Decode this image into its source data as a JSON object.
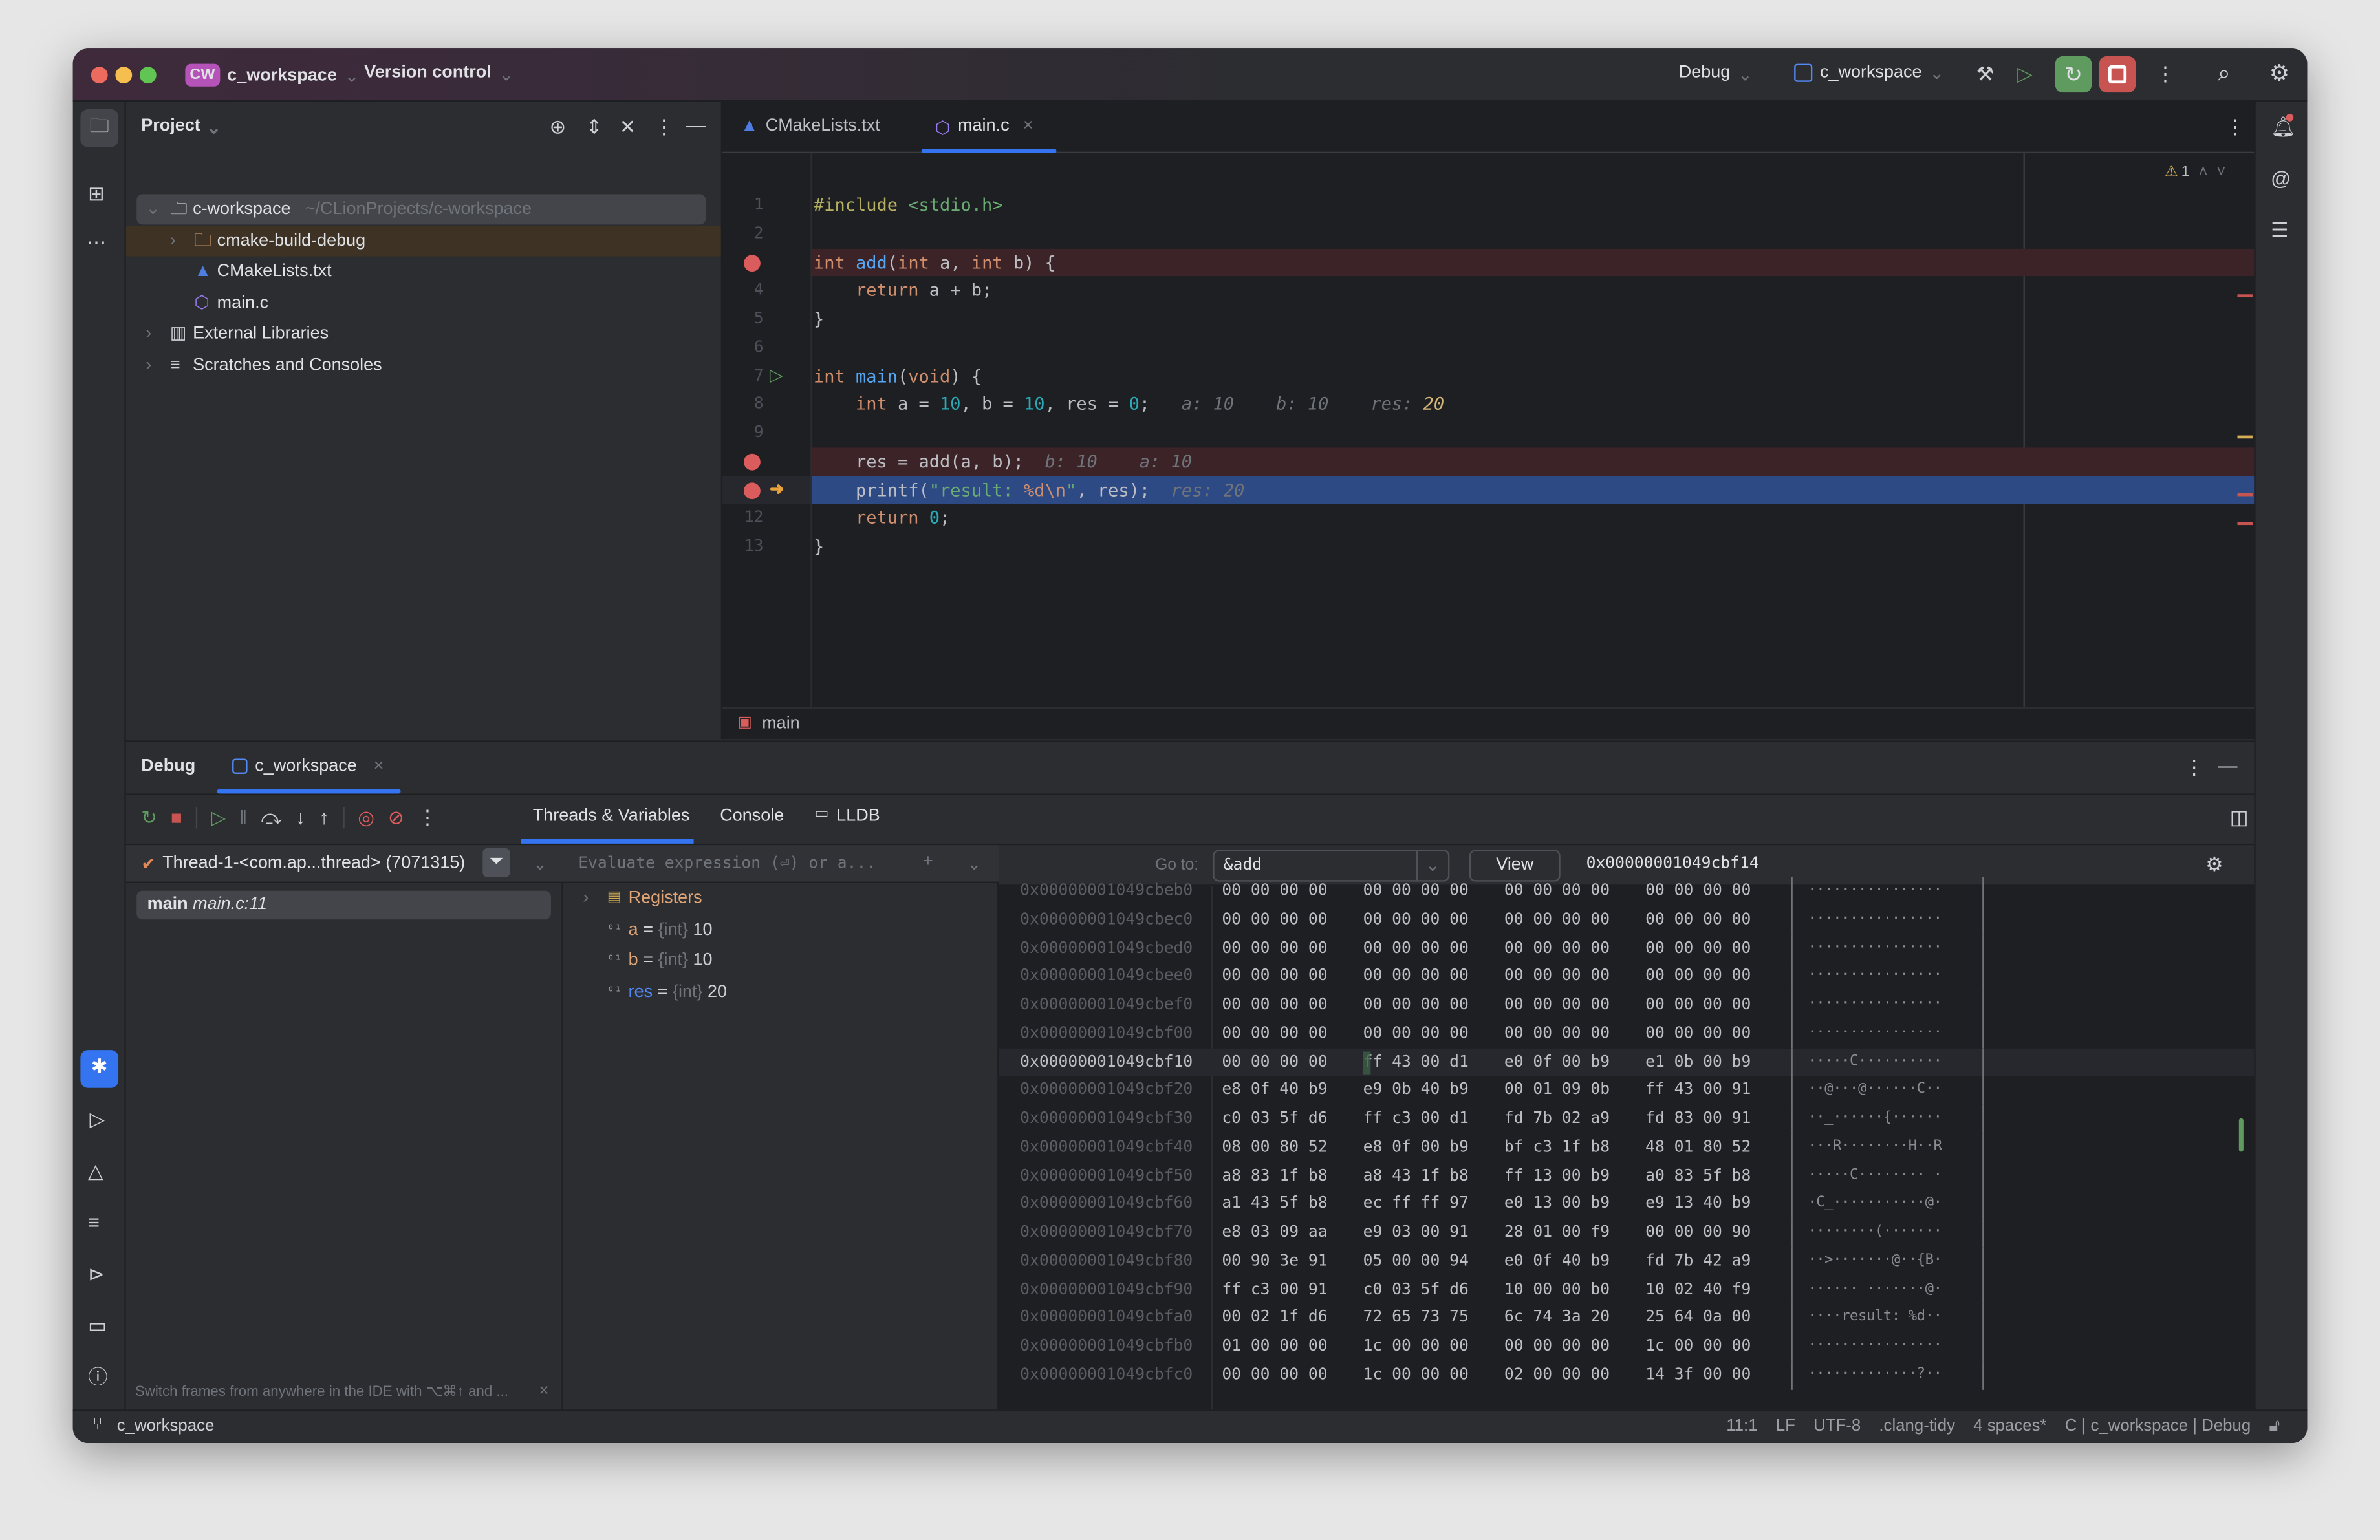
{
  "titlebar": {
    "project_badge": "CW",
    "project": "c_workspace",
    "vcs": "Version control",
    "run_config_mode": "Debug",
    "run_config": "c_workspace"
  },
  "project_panel": {
    "title": "Project",
    "tree": [
      {
        "label": "c-workspace",
        "hint": "~/CLionProjects/c-workspace",
        "icon": "module-folder-icon",
        "depth": 0,
        "expanded": true,
        "selected": true
      },
      {
        "label": "cmake-build-debug",
        "icon": "folder-icon",
        "depth": 1,
        "expanded": false,
        "highlighted": true
      },
      {
        "label": "CMakeLists.txt",
        "icon": "cmake-icon",
        "depth": 1
      },
      {
        "label": "main.c",
        "icon": "c-file-icon",
        "depth": 1
      },
      {
        "label": "External Libraries",
        "icon": "library-icon",
        "depth": 0,
        "expanded": false
      },
      {
        "label": "Scratches and Consoles",
        "icon": "scratches-icon",
        "depth": 0,
        "expanded": false
      }
    ]
  },
  "editor": {
    "tabs": [
      {
        "label": "CMakeLists.txt",
        "active": false
      },
      {
        "label": "main.c",
        "active": true
      }
    ],
    "warnings": "1",
    "breadcrumb": "main",
    "lines": [
      {
        "n": "1",
        "tokens": [
          {
            "t": "#include ",
            "k": "pp"
          },
          {
            "t": "<stdio.h>",
            "k": "str"
          }
        ]
      },
      {
        "n": "2",
        "tokens": []
      },
      {
        "n": "",
        "bp": true,
        "bg": "bp",
        "tokens": [
          {
            "t": "int ",
            "k": "kw"
          },
          {
            "t": "add",
            "k": "fn"
          },
          {
            "t": "(",
            "k": "txt"
          },
          {
            "t": "int ",
            "k": "kw"
          },
          {
            "t": "a, ",
            "k": "txt"
          },
          {
            "t": "int ",
            "k": "kw"
          },
          {
            "t": "b) {",
            "k": "txt"
          }
        ]
      },
      {
        "n": "4",
        "tokens": [
          {
            "t": "    return ",
            "k": "kw"
          },
          {
            "t": "a + b;",
            "k": "txt"
          }
        ]
      },
      {
        "n": "5",
        "tokens": [
          {
            "t": "}",
            "k": "txt"
          }
        ]
      },
      {
        "n": "6",
        "tokens": []
      },
      {
        "n": "7",
        "run": true,
        "tokens": [
          {
            "t": "int ",
            "k": "kw"
          },
          {
            "t": "main",
            "k": "fn"
          },
          {
            "t": "(",
            "k": "txt"
          },
          {
            "t": "void",
            "k": "kw"
          },
          {
            "t": ") {",
            "k": "txt"
          }
        ]
      },
      {
        "n": "8",
        "tokens": [
          {
            "t": "    int ",
            "k": "kw"
          },
          {
            "t": "a = ",
            "k": "txt"
          },
          {
            "t": "10",
            "k": "num"
          },
          {
            "t": ", b = ",
            "k": "txt"
          },
          {
            "t": "10",
            "k": "num"
          },
          {
            "t": ", res = ",
            "k": "txt"
          },
          {
            "t": "0",
            "k": "num"
          },
          {
            "t": ";   ",
            "k": "txt"
          },
          {
            "t": "a: 10    b: 10    res: ",
            "k": "inl"
          },
          {
            "t": "20",
            "k": "inlv"
          }
        ]
      },
      {
        "n": "9",
        "tokens": []
      },
      {
        "n": "",
        "bp": true,
        "bg": "bp",
        "tokens": [
          {
            "t": "    res = add(a, b);  ",
            "k": "txt"
          },
          {
            "t": "b: 10    a: 10",
            "k": "inl"
          }
        ]
      },
      {
        "n": "",
        "bp": true,
        "exec": true,
        "bg": "exec",
        "tokens": [
          {
            "t": "    printf(",
            "k": "txt"
          },
          {
            "t": "\"result: ",
            "k": "str"
          },
          {
            "t": "%d\\n",
            "k": "kw"
          },
          {
            "t": "\"",
            "k": "str"
          },
          {
            "t": ", res);  ",
            "k": "txt"
          },
          {
            "t": "res: 20",
            "k": "inl"
          }
        ]
      },
      {
        "n": "12",
        "tokens": [
          {
            "t": "    return ",
            "k": "kw"
          },
          {
            "t": "0",
            "k": "num"
          },
          {
            "t": ";",
            "k": "txt"
          }
        ]
      },
      {
        "n": "13",
        "tokens": [
          {
            "t": "}",
            "k": "txt"
          }
        ]
      }
    ]
  },
  "debug": {
    "title": "Debug",
    "session_tab": "c_workspace",
    "tabs": [
      {
        "label": "Threads & Variables",
        "active": true
      },
      {
        "label": "Console"
      },
      {
        "label": "LLDB"
      }
    ],
    "thread": "Thread-1-<com.ap...thread> (7071315)",
    "frame": {
      "name": "main",
      "location": "main.c:11"
    },
    "evaluate_placeholder": "Evaluate expression (⏎) or a...",
    "hint": "Switch frames from anywhere in the IDE with ⌥⌘↑ and ...",
    "variables": [
      {
        "name": "Registers",
        "kind": "group"
      },
      {
        "name": "a",
        "type": "{int}",
        "value": "10"
      },
      {
        "name": "b",
        "type": "{int}",
        "value": "10"
      },
      {
        "name": "res",
        "type": "{int}",
        "value": "20",
        "changed": true
      }
    ],
    "memory": {
      "goto_label": "Go to:",
      "goto_value": "&add",
      "view_label": "View",
      "address": "0x00000001049cbf14",
      "rows": [
        {
          "addr": "0x00000001049cbeb0",
          "hex": [
            "00 00 00 00",
            "00 00 00 00",
            "00 00 00 00",
            "00 00 00 00"
          ],
          "ascii": "················"
        },
        {
          "addr": "0x00000001049cbec0",
          "hex": [
            "00 00 00 00",
            "00 00 00 00",
            "00 00 00 00",
            "00 00 00 00"
          ],
          "ascii": "················"
        },
        {
          "addr": "0x00000001049cbed0",
          "hex": [
            "00 00 00 00",
            "00 00 00 00",
            "00 00 00 00",
            "00 00 00 00"
          ],
          "ascii": "················"
        },
        {
          "addr": "0x00000001049cbee0",
          "hex": [
            "00 00 00 00",
            "00 00 00 00",
            "00 00 00 00",
            "00 00 00 00"
          ],
          "ascii": "················"
        },
        {
          "addr": "0x00000001049cbef0",
          "hex": [
            "00 00 00 00",
            "00 00 00 00",
            "00 00 00 00",
            "00 00 00 00"
          ],
          "ascii": "················"
        },
        {
          "addr": "0x00000001049cbf00",
          "hex": [
            "00 00 00 00",
            "00 00 00 00",
            "00 00 00 00",
            "00 00 00 00"
          ],
          "ascii": "················"
        },
        {
          "addr": "0x00000001049cbf10",
          "hex": [
            "00 00 00 00",
            "ff 43 00 d1",
            "e0 0f 00 b9",
            "e1 0b 00 b9"
          ],
          "ascii": "·····C··········",
          "current": true
        },
        {
          "addr": "0x00000001049cbf20",
          "hex": [
            "e8 0f 40 b9",
            "e9 0b 40 b9",
            "00 01 09 0b",
            "ff 43 00 91"
          ],
          "ascii": "··@···@······C··"
        },
        {
          "addr": "0x00000001049cbf30",
          "hex": [
            "c0 03 5f d6",
            "ff c3 00 d1",
            "fd 7b 02 a9",
            "fd 83 00 91"
          ],
          "ascii": "··_······{······"
        },
        {
          "addr": "0x00000001049cbf40",
          "hex": [
            "08 00 80 52",
            "e8 0f 00 b9",
            "bf c3 1f b8",
            "48 01 80 52"
          ],
          "ascii": "···R········H··R"
        },
        {
          "addr": "0x00000001049cbf50",
          "hex": [
            "a8 83 1f b8",
            "a8 43 1f b8",
            "ff 13 00 b9",
            "a0 83 5f b8"
          ],
          "ascii": "·····C········_·"
        },
        {
          "addr": "0x00000001049cbf60",
          "hex": [
            "a1 43 5f b8",
            "ec ff ff 97",
            "e0 13 00 b9",
            "e9 13 40 b9"
          ],
          "ascii": "·C_···········@·"
        },
        {
          "addr": "0x00000001049cbf70",
          "hex": [
            "e8 03 09 aa",
            "e9 03 00 91",
            "28 01 00 f9",
            "00 00 00 90"
          ],
          "ascii": "········(·······"
        },
        {
          "addr": "0x00000001049cbf80",
          "hex": [
            "00 90 3e 91",
            "05 00 00 94",
            "e0 0f 40 b9",
            "fd 7b 42 a9"
          ],
          "ascii": "··>·······@··{B·"
        },
        {
          "addr": "0x00000001049cbf90",
          "hex": [
            "ff c3 00 91",
            "c0 03 5f d6",
            "10 00 00 b0",
            "10 02 40 f9"
          ],
          "ascii": "······_·······@·"
        },
        {
          "addr": "0x00000001049cbfa0",
          "hex": [
            "00 02 1f d6",
            "72 65 73 75",
            "6c 74 3a 20",
            "25 64 0a 00"
          ],
          "ascii": "····result: %d··"
        },
        {
          "addr": "0x00000001049cbfb0",
          "hex": [
            "01 00 00 00",
            "1c 00 00 00",
            "00 00 00 00",
            "1c 00 00 00"
          ],
          "ascii": "················"
        },
        {
          "addr": "0x00000001049cbfc0",
          "hex": [
            "00 00 00 00",
            "1c 00 00 00",
            "02 00 00 00",
            "14 3f 00 00"
          ],
          "ascii": "·············?··"
        }
      ]
    }
  },
  "statusbar": {
    "project": "c_workspace",
    "position": "11:1",
    "line_sep": "LF",
    "encoding": "UTF-8",
    "inspector": ".clang-tidy",
    "indent": "4 spaces*",
    "context": "C | c_workspace | Debug"
  },
  "colors": {
    "accent": "#3574f0",
    "breakpoint": "#db5c5c",
    "exec_line": "#2e4a85",
    "bp_line": "#3b2327",
    "run_green": "#5f9a5f",
    "stop_red": "#c75450"
  }
}
